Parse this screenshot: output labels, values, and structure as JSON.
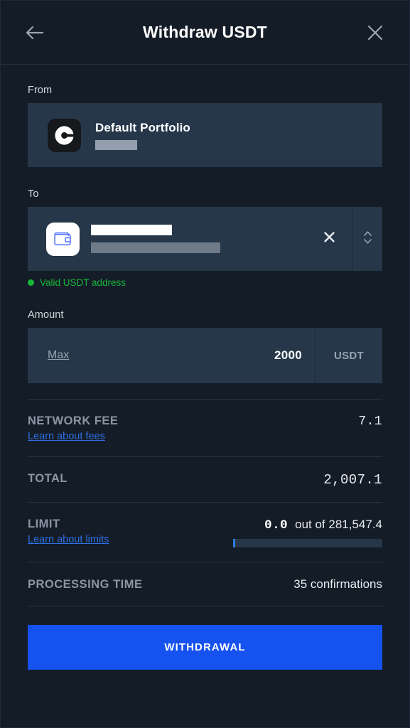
{
  "header": {
    "title": "Withdraw USDT",
    "back_icon": "arrow-left-icon",
    "close_icon": "close-icon"
  },
  "from": {
    "label": "From",
    "portfolio_name": "Default Portfolio",
    "portfolio_sub_redacted": true,
    "logo_icon": "coinbase-logo-icon"
  },
  "to": {
    "label": "To",
    "address_redacted": true,
    "wallet_icon": "wallet-icon",
    "clear_icon": "close-icon",
    "stepper_icon": "chevron-updown-icon",
    "validation_text": "Valid USDT address",
    "validation_color": "#19b43a"
  },
  "amount": {
    "label": "Amount",
    "max_label": "Max",
    "value": "2000",
    "currency": "USDT"
  },
  "summary": {
    "network_fee": {
      "label": "NETWORK FEE",
      "link": "Learn about fees",
      "value": "7.1"
    },
    "total": {
      "label": "TOTAL",
      "value": "2,007.1"
    },
    "limit": {
      "label": "LIMIT",
      "link": "Learn about limits",
      "used": "0.0",
      "out_of": "out of 281,547.4",
      "progress_percent": 0
    },
    "processing_time": {
      "label": "PROCESSING TIME",
      "value": "35 confirmations"
    }
  },
  "cta": {
    "label": "WITHDRAWAL",
    "color": "#1652f0"
  }
}
